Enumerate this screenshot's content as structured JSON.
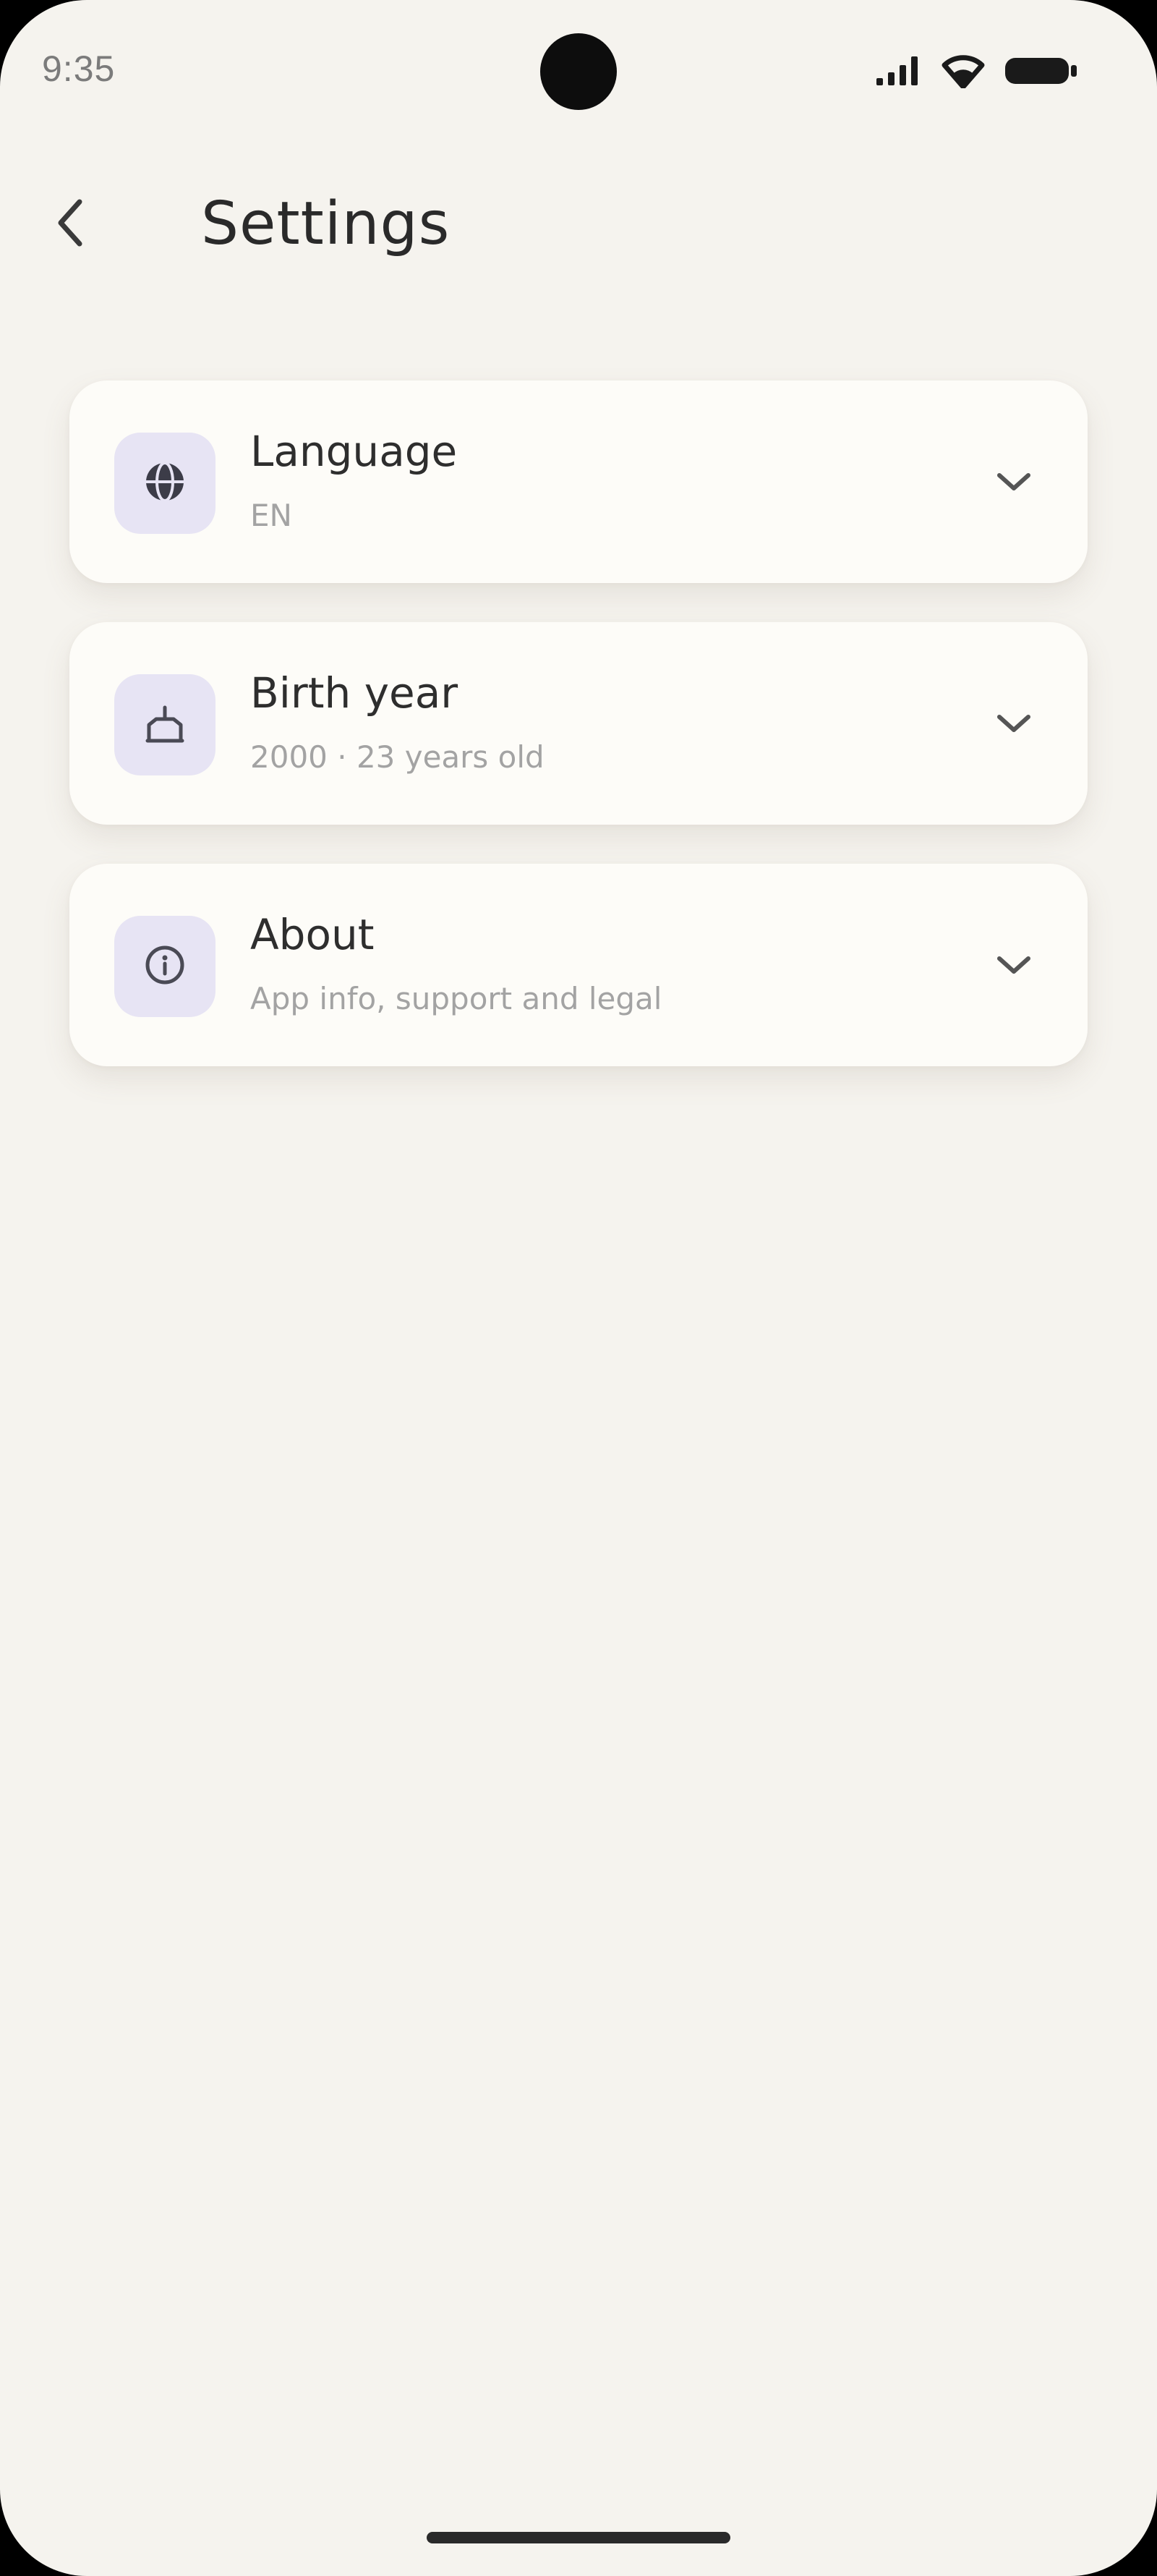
{
  "status_bar": {
    "time": "9:35",
    "icons": [
      "signal-icon",
      "wifi-icon",
      "battery-icon"
    ]
  },
  "header": {
    "back_icon": "back-arrow-icon",
    "title": "Settings"
  },
  "settings": [
    {
      "id": "language",
      "icon": "globe-icon",
      "title": "Language",
      "subtitle": "EN"
    },
    {
      "id": "birth-year",
      "icon": "cake-icon",
      "title": "Birth year",
      "subtitle": "2000 · 23 years old"
    },
    {
      "id": "about",
      "icon": "info-icon",
      "title": "About",
      "subtitle": "App info, support and legal"
    }
  ],
  "colors": {
    "background": "#f5f3ee",
    "card": "#fdfcf8",
    "icon_tile": "#e7e4f4",
    "text_primary": "#2e2e2e",
    "text_secondary": "#a3a3a3"
  }
}
